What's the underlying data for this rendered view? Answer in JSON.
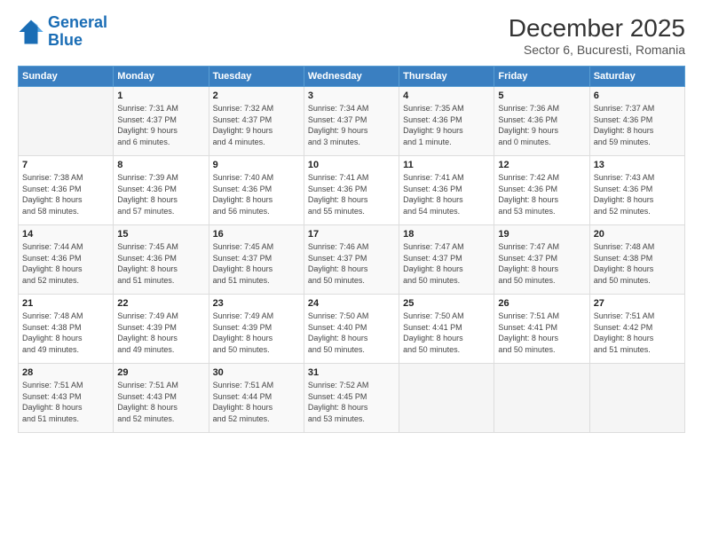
{
  "header": {
    "logo_line1": "General",
    "logo_line2": "Blue",
    "title": "December 2025",
    "subtitle": "Sector 6, Bucuresti, Romania"
  },
  "columns": [
    "Sunday",
    "Monday",
    "Tuesday",
    "Wednesday",
    "Thursday",
    "Friday",
    "Saturday"
  ],
  "weeks": [
    [
      {
        "day": "",
        "content": ""
      },
      {
        "day": "1",
        "content": "Sunrise: 7:31 AM\nSunset: 4:37 PM\nDaylight: 9 hours\nand 6 minutes."
      },
      {
        "day": "2",
        "content": "Sunrise: 7:32 AM\nSunset: 4:37 PM\nDaylight: 9 hours\nand 4 minutes."
      },
      {
        "day": "3",
        "content": "Sunrise: 7:34 AM\nSunset: 4:37 PM\nDaylight: 9 hours\nand 3 minutes."
      },
      {
        "day": "4",
        "content": "Sunrise: 7:35 AM\nSunset: 4:36 PM\nDaylight: 9 hours\nand 1 minute."
      },
      {
        "day": "5",
        "content": "Sunrise: 7:36 AM\nSunset: 4:36 PM\nDaylight: 9 hours\nand 0 minutes."
      },
      {
        "day": "6",
        "content": "Sunrise: 7:37 AM\nSunset: 4:36 PM\nDaylight: 8 hours\nand 59 minutes."
      }
    ],
    [
      {
        "day": "7",
        "content": "Sunrise: 7:38 AM\nSunset: 4:36 PM\nDaylight: 8 hours\nand 58 minutes."
      },
      {
        "day": "8",
        "content": "Sunrise: 7:39 AM\nSunset: 4:36 PM\nDaylight: 8 hours\nand 57 minutes."
      },
      {
        "day": "9",
        "content": "Sunrise: 7:40 AM\nSunset: 4:36 PM\nDaylight: 8 hours\nand 56 minutes."
      },
      {
        "day": "10",
        "content": "Sunrise: 7:41 AM\nSunset: 4:36 PM\nDaylight: 8 hours\nand 55 minutes."
      },
      {
        "day": "11",
        "content": "Sunrise: 7:41 AM\nSunset: 4:36 PM\nDaylight: 8 hours\nand 54 minutes."
      },
      {
        "day": "12",
        "content": "Sunrise: 7:42 AM\nSunset: 4:36 PM\nDaylight: 8 hours\nand 53 minutes."
      },
      {
        "day": "13",
        "content": "Sunrise: 7:43 AM\nSunset: 4:36 PM\nDaylight: 8 hours\nand 52 minutes."
      }
    ],
    [
      {
        "day": "14",
        "content": "Sunrise: 7:44 AM\nSunset: 4:36 PM\nDaylight: 8 hours\nand 52 minutes."
      },
      {
        "day": "15",
        "content": "Sunrise: 7:45 AM\nSunset: 4:36 PM\nDaylight: 8 hours\nand 51 minutes."
      },
      {
        "day": "16",
        "content": "Sunrise: 7:45 AM\nSunset: 4:37 PM\nDaylight: 8 hours\nand 51 minutes."
      },
      {
        "day": "17",
        "content": "Sunrise: 7:46 AM\nSunset: 4:37 PM\nDaylight: 8 hours\nand 50 minutes."
      },
      {
        "day": "18",
        "content": "Sunrise: 7:47 AM\nSunset: 4:37 PM\nDaylight: 8 hours\nand 50 minutes."
      },
      {
        "day": "19",
        "content": "Sunrise: 7:47 AM\nSunset: 4:37 PM\nDaylight: 8 hours\nand 50 minutes."
      },
      {
        "day": "20",
        "content": "Sunrise: 7:48 AM\nSunset: 4:38 PM\nDaylight: 8 hours\nand 50 minutes."
      }
    ],
    [
      {
        "day": "21",
        "content": "Sunrise: 7:48 AM\nSunset: 4:38 PM\nDaylight: 8 hours\nand 49 minutes."
      },
      {
        "day": "22",
        "content": "Sunrise: 7:49 AM\nSunset: 4:39 PM\nDaylight: 8 hours\nand 49 minutes."
      },
      {
        "day": "23",
        "content": "Sunrise: 7:49 AM\nSunset: 4:39 PM\nDaylight: 8 hours\nand 50 minutes."
      },
      {
        "day": "24",
        "content": "Sunrise: 7:50 AM\nSunset: 4:40 PM\nDaylight: 8 hours\nand 50 minutes."
      },
      {
        "day": "25",
        "content": "Sunrise: 7:50 AM\nSunset: 4:41 PM\nDaylight: 8 hours\nand 50 minutes."
      },
      {
        "day": "26",
        "content": "Sunrise: 7:51 AM\nSunset: 4:41 PM\nDaylight: 8 hours\nand 50 minutes."
      },
      {
        "day": "27",
        "content": "Sunrise: 7:51 AM\nSunset: 4:42 PM\nDaylight: 8 hours\nand 51 minutes."
      }
    ],
    [
      {
        "day": "28",
        "content": "Sunrise: 7:51 AM\nSunset: 4:43 PM\nDaylight: 8 hours\nand 51 minutes."
      },
      {
        "day": "29",
        "content": "Sunrise: 7:51 AM\nSunset: 4:43 PM\nDaylight: 8 hours\nand 52 minutes."
      },
      {
        "day": "30",
        "content": "Sunrise: 7:51 AM\nSunset: 4:44 PM\nDaylight: 8 hours\nand 52 minutes."
      },
      {
        "day": "31",
        "content": "Sunrise: 7:52 AM\nSunset: 4:45 PM\nDaylight: 8 hours\nand 53 minutes."
      },
      {
        "day": "",
        "content": ""
      },
      {
        "day": "",
        "content": ""
      },
      {
        "day": "",
        "content": ""
      }
    ]
  ]
}
